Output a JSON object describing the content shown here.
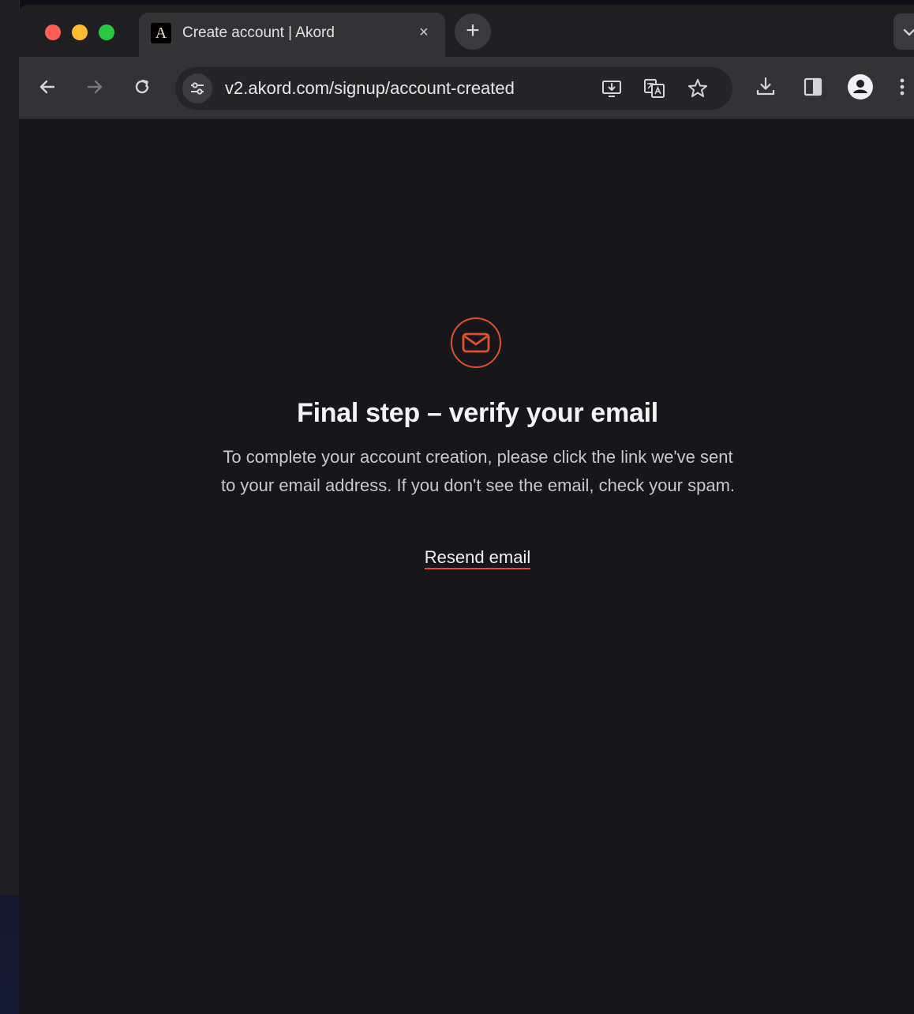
{
  "browser": {
    "tab": {
      "favicon_letter": "A",
      "title": "Create account | Akord",
      "close_glyph": "×"
    },
    "new_tab_glyph": "+",
    "address_bar": {
      "url": "v2.akord.com/signup/account-created"
    },
    "icons": [
      "back-icon",
      "forward-icon",
      "reload-icon",
      "site-info-icon",
      "install-app-icon",
      "translate-icon",
      "bookmark-star-icon",
      "download-icon",
      "side-panel-icon",
      "profile-icon",
      "menu-icon"
    ]
  },
  "page": {
    "icon": "mail-icon",
    "heading": "Final step – verify your email",
    "body": "To complete your account creation, please click the link we've sent to your email address. If you don't see the email, check your spam.",
    "resend_label": "Resend email"
  },
  "colors": {
    "accent": "#e0522a",
    "background": "#17171b",
    "toolbar": "#333336"
  }
}
